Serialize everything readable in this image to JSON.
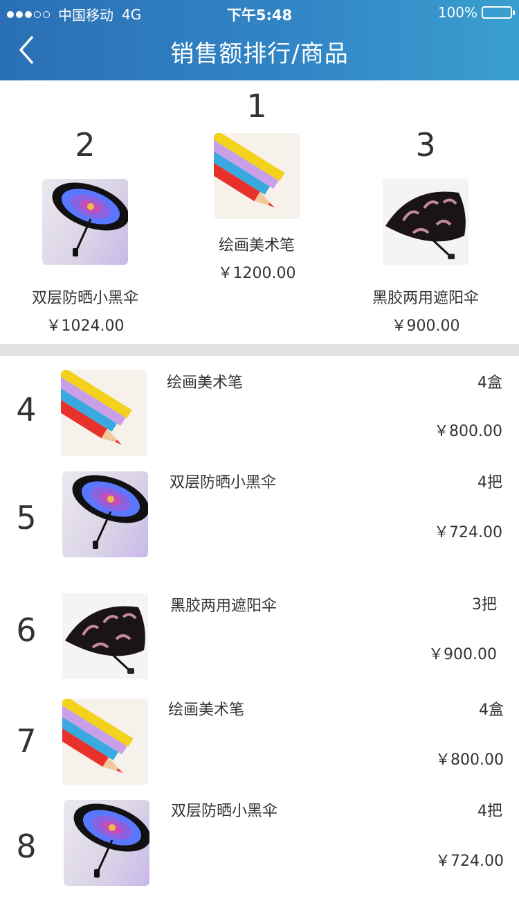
{
  "status_bar": {
    "carrier": "中国移动",
    "network": "4G",
    "time": "下午5:48",
    "battery": "100%"
  },
  "nav": {
    "back_icon": "chevron-left-icon",
    "title": "销售额排行/商品"
  },
  "podium": [
    {
      "rank": "2",
      "name": "双层防晒小黑伞",
      "price": "￥1024.00",
      "image": "umbrella-blue-icon"
    },
    {
      "rank": "1",
      "name": "绘画美术笔",
      "price": "￥1200.00",
      "image": "colored-pencils-icon"
    },
    {
      "rank": "3",
      "name": "黑胶两用遮阳伞",
      "price": "￥900.00",
      "image": "umbrella-black-icon"
    }
  ],
  "list": [
    {
      "rank": "4",
      "name": "绘画美术笔",
      "qty": "4盒",
      "price": "￥800.00",
      "image": "colored-pencils-icon"
    },
    {
      "rank": "5",
      "name": "双层防晒小黑伞",
      "qty": "4把",
      "price": "￥724.00",
      "image": "umbrella-blue-icon"
    },
    {
      "rank": "6",
      "name": "黑胶两用遮阳伞",
      "qty": "3把",
      "price": "￥900.00",
      "image": "umbrella-black-icon"
    },
    {
      "rank": "7",
      "name": "绘画美术笔",
      "qty": "4盒",
      "price": "￥800.00",
      "image": "colored-pencils-icon"
    },
    {
      "rank": "8",
      "name": "双层防晒小黑伞",
      "qty": "4把",
      "price": "￥724.00",
      "image": "umbrella-blue-icon"
    }
  ],
  "colors": {
    "header_start": "#2a6fb5",
    "header_end": "#3a9fcf",
    "divider": "#e1e1e1"
  }
}
